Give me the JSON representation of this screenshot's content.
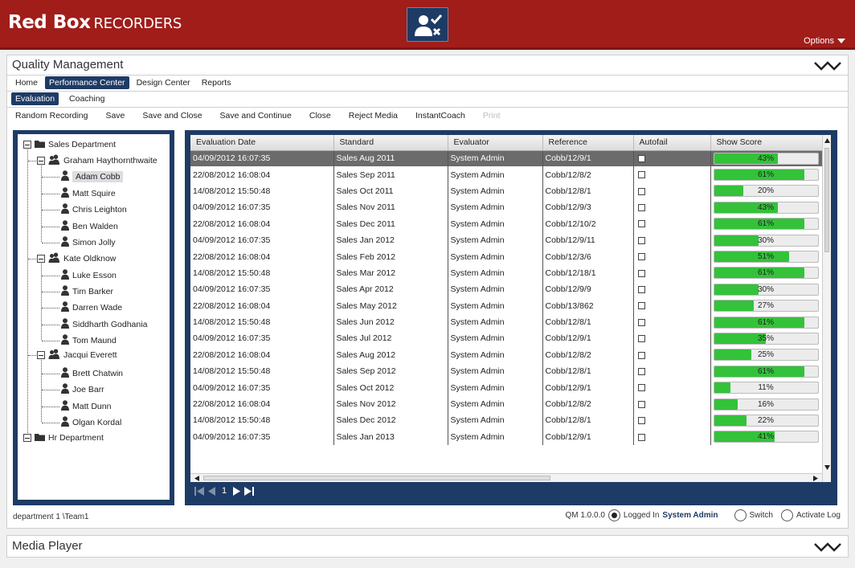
{
  "header": {
    "logo_main": "Red Box",
    "logo_sub": "RECORDERS",
    "options_label": "Options"
  },
  "qm": {
    "title": "Quality Management",
    "nav": [
      "Home",
      "Performance Center",
      "Design Center",
      "Reports"
    ],
    "nav_active": "Performance Center",
    "subnav": [
      "Evaluation",
      "Coaching"
    ],
    "subnav_active": "Evaluation",
    "toolbar": {
      "random_recording": "Random Recording",
      "save": "Save",
      "save_close": "Save and Close",
      "save_continue": "Save and Continue",
      "close": "Close",
      "reject_media": "Reject Media",
      "instant_coach": "InstantCoach",
      "print": "Print"
    }
  },
  "tree": {
    "nodes": [
      {
        "label": "Sales Department",
        "type": "folder",
        "level": 0
      },
      {
        "label": "Graham Haythornthwaite",
        "type": "group",
        "level": 1
      },
      {
        "label": "Adam Cobb",
        "type": "person",
        "level": 2,
        "selected": true
      },
      {
        "label": "Matt Squire",
        "type": "person",
        "level": 2
      },
      {
        "label": "Chris Leighton",
        "type": "person",
        "level": 2
      },
      {
        "label": "Ben Walden",
        "type": "person",
        "level": 2
      },
      {
        "label": "Simon Jolly",
        "type": "person",
        "level": 2
      },
      {
        "label": "Kate Oldknow",
        "type": "group",
        "level": 1
      },
      {
        "label": "Luke Esson",
        "type": "person",
        "level": 2
      },
      {
        "label": "Tim Barker",
        "type": "person",
        "level": 2
      },
      {
        "label": "Darren Wade",
        "type": "person",
        "level": 2
      },
      {
        "label": "Siddharth Godhania",
        "type": "person",
        "level": 2
      },
      {
        "label": "Tom Maund",
        "type": "person",
        "level": 2
      },
      {
        "label": "Jacqui Everett",
        "type": "group",
        "level": 1
      },
      {
        "label": "Brett Chatwin",
        "type": "person",
        "level": 2
      },
      {
        "label": "Joe Barr",
        "type": "person",
        "level": 2
      },
      {
        "label": "Matt Dunn",
        "type": "person",
        "level": 2
      },
      {
        "label": "Olgan Kordal",
        "type": "person",
        "level": 2
      },
      {
        "label": "Hr Department",
        "type": "folder",
        "level": 0
      }
    ]
  },
  "grid": {
    "columns": [
      "Evaluation Date",
      "Standard",
      "Evaluator",
      "Reference",
      "Autofail",
      "Show Score"
    ],
    "rows": [
      {
        "date": "04/09/2012  16:07:35",
        "standard": "Sales Aug 2011",
        "evaluator": "System Admin",
        "reference": "Cobb/12/9/1",
        "score": 43
      },
      {
        "date": "22/08/2012  16:08:04",
        "standard": "Sales Sep 2011",
        "evaluator": "System Admin",
        "reference": "Cobb/12/8/2",
        "score": 61
      },
      {
        "date": "14/08/2012  15:50:48",
        "standard": "Sales Oct 2011",
        "evaluator": "System Admin",
        "reference": "Cobb/12/8/1",
        "score": 20
      },
      {
        "date": "04/09/2012  16:07:35",
        "standard": "Sales Nov 2011",
        "evaluator": "System Admin",
        "reference": "Cobb/12/9/3",
        "score": 43
      },
      {
        "date": "22/08/2012  16:08:04",
        "standard": "Sales Dec 2011",
        "evaluator": "System Admin",
        "reference": "Cobb/12/10/2",
        "score": 61
      },
      {
        "date": "04/09/2012  16:07:35",
        "standard": "Sales Jan 2012",
        "evaluator": "System Admin",
        "reference": "Cobb/12/9/11",
        "score": 30
      },
      {
        "date": "22/08/2012  16:08:04",
        "standard": "Sales Feb 2012",
        "evaluator": "System Admin",
        "reference": "Cobb/12/3/6",
        "score": 51
      },
      {
        "date": "14/08/2012  15:50:48",
        "standard": "Sales Mar 2012",
        "evaluator": "System Admin",
        "reference": "Cobb/12/18/1",
        "score": 61
      },
      {
        "date": "04/09/2012  16:07:35",
        "standard": "Sales Apr 2012",
        "evaluator": "System Admin",
        "reference": "Cobb/12/9/9",
        "score": 30
      },
      {
        "date": "22/08/2012  16:08:04",
        "standard": "Sales May 2012",
        "evaluator": "System Admin",
        "reference": "Cobb/13/862",
        "score": 27
      },
      {
        "date": "14/08/2012  15:50:48",
        "standard": "Sales Jun 2012",
        "evaluator": "System Admin",
        "reference": "Cobb/12/8/1",
        "score": 61
      },
      {
        "date": "04/09/2012  16:07:35",
        "standard": "Sales Jul 2012",
        "evaluator": "System Admin",
        "reference": "Cobb/12/9/1",
        "score": 35
      },
      {
        "date": "22/08/2012  16:08:04",
        "standard": "Sales Aug 2012",
        "evaluator": "System Admin",
        "reference": "Cobb/12/8/2",
        "score": 25
      },
      {
        "date": "14/08/2012  15:50:48",
        "standard": "Sales Sep 2012",
        "evaluator": "System Admin",
        "reference": "Cobb/12/8/1",
        "score": 61
      },
      {
        "date": "04/09/2012  16:07:35",
        "standard": "Sales Oct 2012",
        "evaluator": "System Admin",
        "reference": "Cobb/12/9/1",
        "score": 11
      },
      {
        "date": "22/08/2012  16:08:04",
        "standard": "Sales Nov 2012",
        "evaluator": "System Admin",
        "reference": "Cobb/12/8/2",
        "score": 16
      },
      {
        "date": "14/08/2012  15:50:48",
        "standard": "Sales Dec 2012",
        "evaluator": "System Admin",
        "reference": "Cobb/12/8/1",
        "score": 22
      },
      {
        "date": "04/09/2012  16:07:35",
        "standard": "Sales Jan 2013",
        "evaluator": "System Admin",
        "reference": "Cobb/12/9/1",
        "score": 41
      }
    ],
    "selected_row": 0,
    "pager_page": "1"
  },
  "status": {
    "dept_path": "department 1 \\Team1",
    "version": "QM 1.0.0.0",
    "logged_in_label": "Logged In",
    "user": "System Admin",
    "switch_label": "Switch",
    "activate_log_label": "Activate Log"
  },
  "media_player": {
    "title": "Media Player"
  },
  "colors": {
    "brand_red": "#a01d1a",
    "navy": "#1e3b65",
    "score_green": "#33c23a"
  }
}
